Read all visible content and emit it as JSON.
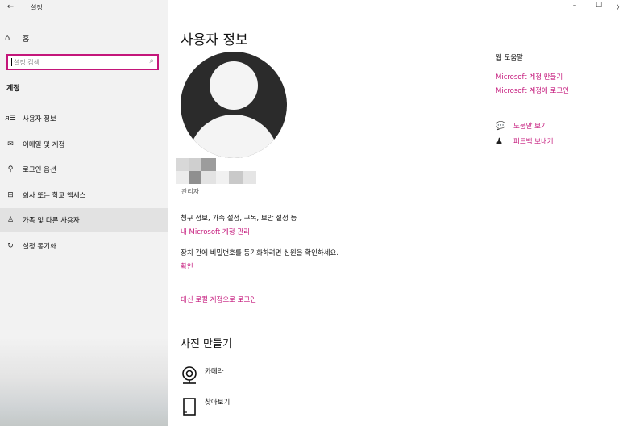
{
  "window": {
    "title": "설정",
    "minimize_label": "–",
    "maximize_label": "☐",
    "close_label": "〉"
  },
  "sidebar": {
    "back_label": "←",
    "home_label": "홈",
    "search_placeholder": "설정 검색",
    "section_title": "계정",
    "items": [
      {
        "label": "사용자 정보",
        "icon": "user-info-icon",
        "glyph": "ꕤ"
      },
      {
        "label": "이메일 및 계정",
        "icon": "mail-icon",
        "glyph": "✉"
      },
      {
        "label": "로그인 옵션",
        "icon": "key-icon",
        "glyph": "⚲"
      },
      {
        "label": "회사 또는 학교 액세스",
        "icon": "briefcase-icon",
        "glyph": "⊟"
      },
      {
        "label": "가족 및 다른 사용자",
        "icon": "people-icon",
        "glyph": "♙"
      },
      {
        "label": "설정 동기화",
        "icon": "sync-icon",
        "glyph": "↻"
      }
    ],
    "selected_index": 4
  },
  "main": {
    "title": "사용자 정보",
    "role": "관리자",
    "billing_text": "청구 정보, 가족 설정, 구독, 보안 설정 등",
    "manage_account_link": "내 Microsoft 계정 관리",
    "sync_text": "장치 간에 비밀번호를 동기화하려면 신원을 확인하세요.",
    "verify_link": "확인",
    "local_signin_link": "대신 로컬 계정으로 로그인",
    "create_photo_title": "사진 만들기",
    "camera_label": "카메라",
    "browse_label": "찾아보기"
  },
  "help_panel": {
    "title": "웹 도움말",
    "links": [
      "Microsoft 계정 만들기",
      "Microsoft 계정에 로그인"
    ],
    "get_help": "도움말 보기",
    "feedback": "피드백 보내기"
  },
  "colors": {
    "accent": "#c4167a",
    "sidebar_bg": "#f2f2f2",
    "selected_bg": "#e2e2e2"
  }
}
